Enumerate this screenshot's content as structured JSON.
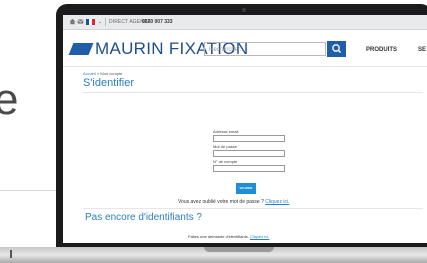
{
  "backdrop": {
    "partial_glyph": "e"
  },
  "topbar": {
    "home_icon": "home-icon",
    "mail_icon": "mail-icon",
    "flag_colors": [
      "#1f4ea3",
      "#ffffff",
      "#e0262b"
    ],
    "chevron": "⌄",
    "direct_agence": "DIRECT AGENCE",
    "phone": "0820 007 333"
  },
  "header": {
    "logo_text": "MAURIN FIXATION",
    "search_placeholder": "Rechercher...",
    "nav_items": [
      "PRODUITS",
      "SE"
    ]
  },
  "breadcrumb": {
    "home": "Accueil",
    "sep": "»",
    "current": "Mon compte"
  },
  "page": {
    "title": "S'identifier",
    "email_label": "Adresse email",
    "password_label": "Mot de passe",
    "account_label": "N° de compte",
    "submit_label": "VALIDER",
    "forgot_text": "Vous avez oublié votre mot de passe ?",
    "forgot_link": "Cliquez ici.",
    "no_ids_title": "Pas encore d'identifiants ?",
    "ask_text": "Faites une demande d'identifiants.",
    "ask_link": "Cliquez ici."
  },
  "colors": {
    "brand_blue": "#1f5fa8",
    "link_blue": "#2a7fc0",
    "button_blue": "#1e8fd6",
    "laptop_bezel": "#1b1b1d"
  }
}
